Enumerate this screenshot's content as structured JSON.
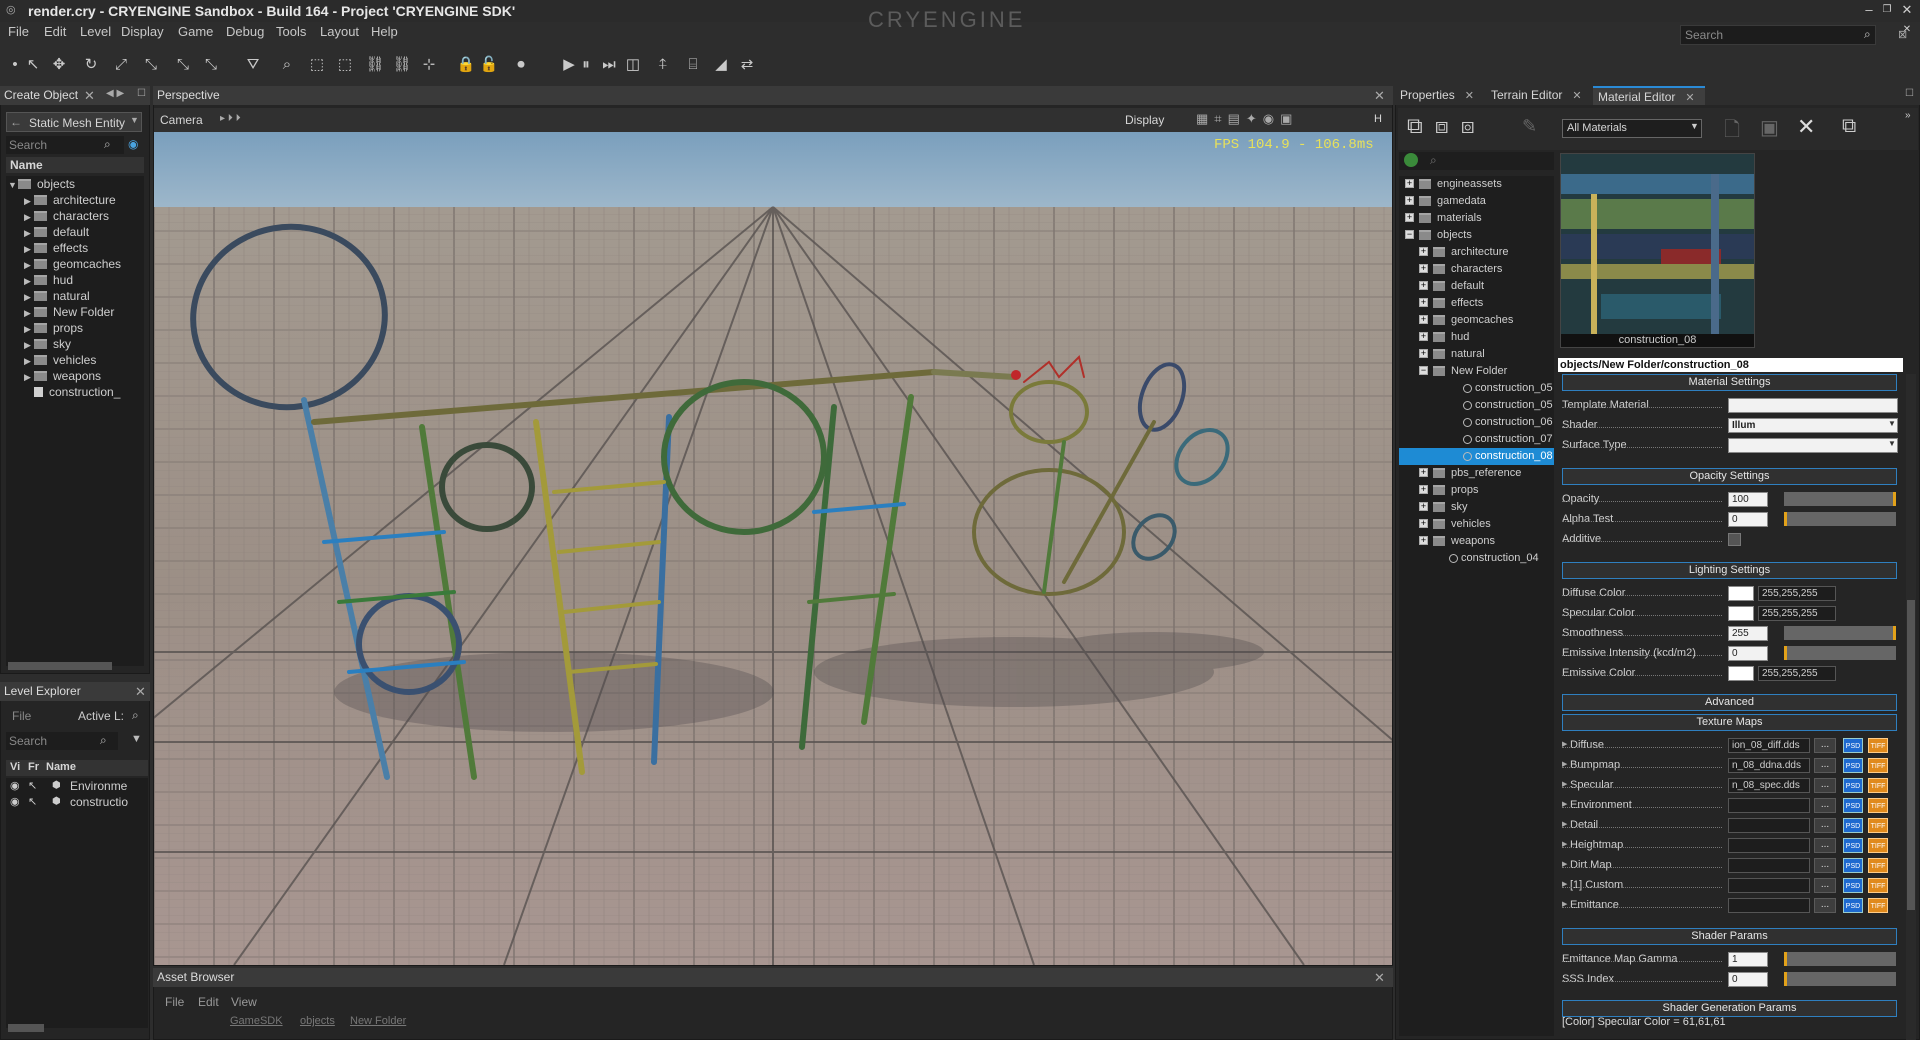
{
  "app": {
    "title": "render.cry - CRYENGINE Sandbox - Build 164 - Project 'CRYENGINE SDK'",
    "logo": "CRYENGINE",
    "search_placeholder": "Search"
  },
  "menu": [
    "File",
    "Edit",
    "Level",
    "Display",
    "Game",
    "Debug",
    "Tools",
    "Layout",
    "Help"
  ],
  "create_object": {
    "title": "Create Object",
    "category": "Static Mesh Entity",
    "search_placeholder": "Search",
    "column": "Name",
    "tree": [
      "objects",
      "architecture",
      "characters",
      "default",
      "effects",
      "geomcaches",
      "hud",
      "natural",
      "New Folder",
      "props",
      "sky",
      "vehicles",
      "weapons",
      "construction_"
    ]
  },
  "level_explorer": {
    "title": "Level Explorer",
    "menu_file": "File",
    "active_layer": "Active L:",
    "search_placeholder": "Search",
    "col_vis": "Vi",
    "col_freeze": "Fr",
    "col_name": "Name",
    "rows": [
      "Environme",
      "constructio"
    ]
  },
  "viewport": {
    "title": "Perspective",
    "camera_label": "Camera",
    "display_label": "Display",
    "h_label": "H",
    "fps": "FPS 104.9 - 106.8ms"
  },
  "asset_browser": {
    "title": "Asset Browser",
    "menu": [
      "File",
      "Edit",
      "View"
    ],
    "breadcrumbs": [
      "GameSDK",
      "objects",
      "New Folder"
    ]
  },
  "right_tabs": [
    "Properties",
    "Terrain Editor",
    "Material Editor"
  ],
  "material_editor": {
    "filter": "All Materials",
    "preview_name": "construction_08",
    "path": "objects/New Folder/construction_08",
    "tree": [
      {
        "label": "engineassets",
        "type": "root"
      },
      {
        "label": "gamedata",
        "type": "root"
      },
      {
        "label": "materials",
        "type": "root"
      },
      {
        "label": "objects",
        "type": "root-open"
      },
      {
        "label": "architecture",
        "type": "sub"
      },
      {
        "label": "characters",
        "type": "sub"
      },
      {
        "label": "default",
        "type": "sub"
      },
      {
        "label": "effects",
        "type": "sub"
      },
      {
        "label": "geomcaches",
        "type": "sub"
      },
      {
        "label": "hud",
        "type": "sub"
      },
      {
        "label": "natural",
        "type": "sub"
      },
      {
        "label": "New Folder",
        "type": "sub-open"
      },
      {
        "label": "construction_05",
        "type": "mat"
      },
      {
        "label": "construction_05",
        "type": "mat"
      },
      {
        "label": "construction_06",
        "type": "mat"
      },
      {
        "label": "construction_07",
        "type": "mat"
      },
      {
        "label": "construction_08",
        "type": "mat-sel"
      },
      {
        "label": "pbs_reference",
        "type": "sub"
      },
      {
        "label": "props",
        "type": "sub"
      },
      {
        "label": "sky",
        "type": "sub"
      },
      {
        "label": "vehicles",
        "type": "sub"
      },
      {
        "label": "weapons",
        "type": "sub"
      },
      {
        "label": "construction_04",
        "type": "mat-root"
      }
    ],
    "sections": {
      "material": "Material Settings",
      "opacity": "Opacity Settings",
      "lighting": "Lighting Settings",
      "advanced": "Advanced",
      "texture": "Texture Maps",
      "shader_params": "Shader Params",
      "shader_gen": "Shader Generation Params"
    },
    "template_label": "Template Material",
    "shader_label": "Shader",
    "shader_value": "Illum",
    "surface_label": "Surface Type",
    "opacity_label": "Opacity",
    "opacity_value": "100",
    "alpha_label": "Alpha Test",
    "alpha_value": "0",
    "additive_label": "Additive",
    "diffuse_color_label": "Diffuse Color",
    "diffuse_color": "255,255,255",
    "specular_color_label": "Specular Color",
    "specular_color": "255,255,255",
    "smoothness_label": "Smoothness",
    "smoothness": "255",
    "emissive_int_label": "Emissive Intensity (kcd/m2)",
    "emissive_int": "0",
    "emissive_color_label": "Emissive Color",
    "emissive_color": "255,255,255",
    "textures": [
      {
        "label": "Diffuse",
        "value": "ion_08_diff.dds"
      },
      {
        "label": "Bumpmap",
        "value": "n_08_ddna.dds"
      },
      {
        "label": "Specular",
        "value": "n_08_spec.dds"
      },
      {
        "label": "Environment",
        "value": ""
      },
      {
        "label": "Detail",
        "value": ""
      },
      {
        "label": "Heightmap",
        "value": ""
      },
      {
        "label": "Dirt Map",
        "value": ""
      },
      {
        "label": "[1] Custom",
        "value": ""
      },
      {
        "label": "Emittance",
        "value": ""
      }
    ],
    "emit_gamma_label": "Emittance Map Gamma",
    "emit_gamma": "1",
    "sss_label": "SSS Index",
    "sss": "0",
    "status": "[Color] Specular Color = 61,61,61"
  }
}
